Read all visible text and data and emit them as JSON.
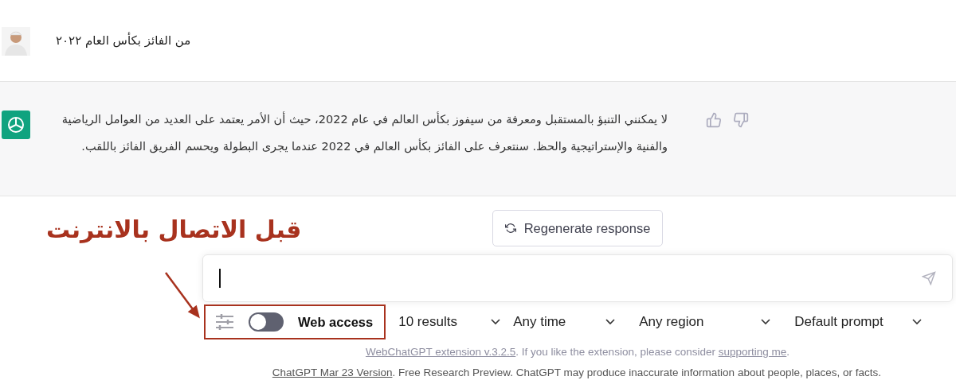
{
  "user_message": {
    "text": "من الفائز بكأس العام ٢٠٢٢"
  },
  "assistant_message": {
    "text": "لا يمكنني التنبؤ بالمستقبل ومعرفة من سيفوز بكأس العالم في عام 2022، حيث أن الأمر يعتمد على العديد من العوامل الرياضية والفنية والإستراتيجية والحظ. سنتعرف على الفائز بكأس العالم في 2022 عندما يجرى البطولة ويحسم الفريق الفائز باللقب."
  },
  "annotation": {
    "text": "قبل الاتصال بالانترنت"
  },
  "regenerate_button": {
    "label": "Regenerate response"
  },
  "toolbar": {
    "web_access": {
      "label": "Web access",
      "on": false
    },
    "dropdowns": [
      {
        "label": "10 results"
      },
      {
        "label": "Any time"
      },
      {
        "label": "Any region"
      },
      {
        "label": "Default prompt"
      }
    ]
  },
  "extension_note": {
    "link": "WebChatGPT extension v.3.2.5",
    "text": ". If you like the extension, please consider ",
    "link_2": "supporting me",
    "end": "."
  },
  "footer": {
    "link": "ChatGPT Mar 23 Version",
    "text": ". Free Research Preview. ChatGPT may produce inaccurate information about people, places, or facts."
  }
}
